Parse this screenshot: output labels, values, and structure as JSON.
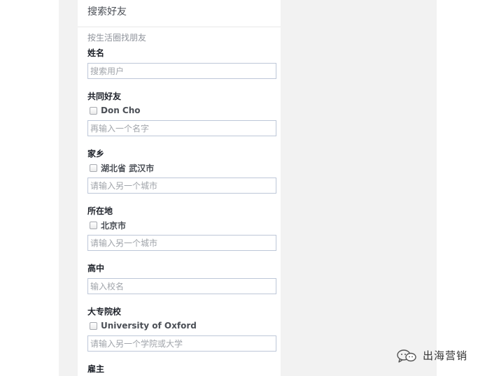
{
  "panel": {
    "title": "搜索好友",
    "subtitle": "按生活圈找朋友"
  },
  "sections": {
    "name": {
      "label": "姓名",
      "placeholder": "搜索用户"
    },
    "mutual_friends": {
      "label": "共同好友",
      "checkbox_label": "Don Cho",
      "checked": false,
      "placeholder": "再输入一个名字"
    },
    "hometown": {
      "label": "家乡",
      "checkbox_label": "湖北省 武汉市",
      "checked": false,
      "placeholder": "请输入另一个城市"
    },
    "current_city": {
      "label": "所在地",
      "checkbox_label": "北京市",
      "checked": false,
      "placeholder": "请输入另一个城市"
    },
    "high_school": {
      "label": "高中",
      "placeholder": "输入校名"
    },
    "college": {
      "label": "大专院校",
      "checkbox_label": "University of Oxford",
      "checked": false,
      "placeholder": "请输入另一个学院或大学"
    },
    "employer": {
      "label": "雇主"
    }
  },
  "watermark": {
    "text": "出海营销",
    "icon": "wechat-icon"
  }
}
